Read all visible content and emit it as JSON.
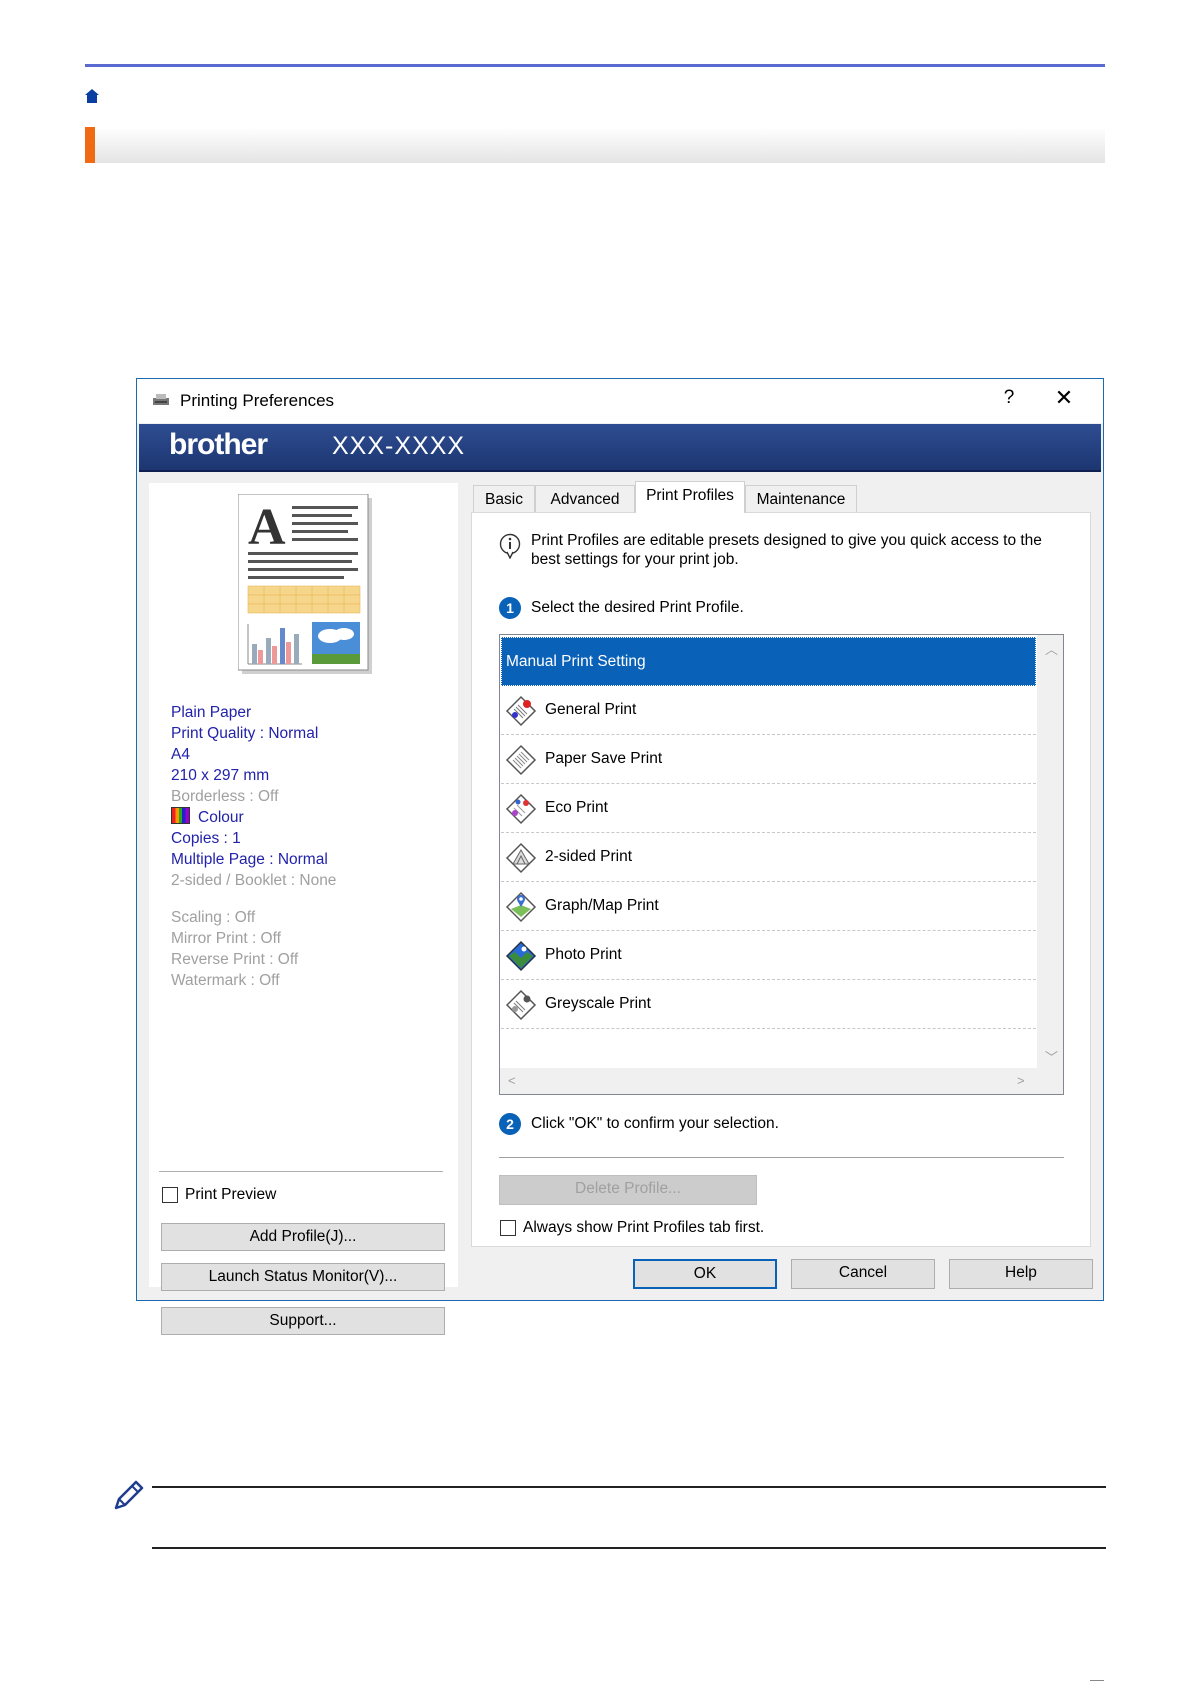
{
  "dialog": {
    "title": "Printing Preferences",
    "help_glyph": "?",
    "close_glyph": "✕",
    "brand": "brother",
    "model": "XXX-XXXX"
  },
  "preview": {
    "settings_summary": [
      {
        "text": "Plain Paper",
        "state": "active"
      },
      {
        "text": "Print Quality : Normal",
        "state": "active"
      },
      {
        "text": "A4",
        "state": "active"
      },
      {
        "text": "210 x 297 mm",
        "state": "active"
      },
      {
        "text": "Borderless : Off",
        "state": "inactive"
      },
      {
        "text": "Colour",
        "state": "active",
        "icon": "colour-swatch-icon"
      },
      {
        "text": "Copies : 1",
        "state": "active"
      },
      {
        "text": "Multiple Page : Normal",
        "state": "active"
      },
      {
        "text": "2-sided / Booklet : None",
        "state": "inactive"
      }
    ],
    "settings_extra": [
      "Scaling : Off",
      "Mirror Print : Off",
      "Reverse Print : Off",
      "Watermark : Off"
    ],
    "print_preview_label": "Print Preview",
    "print_preview_checked": false,
    "buttons": {
      "add_profile": "Add Profile(J)...",
      "launch_status": "Launch Status Monitor(V)...",
      "support": "Support..."
    }
  },
  "tabs": [
    {
      "label": "Basic",
      "active": false
    },
    {
      "label": "Advanced",
      "active": false
    },
    {
      "label": "Print Profiles",
      "active": true
    },
    {
      "label": "Maintenance",
      "active": false
    }
  ],
  "profiles_tab": {
    "info_text": "Print Profiles are editable presets designed to give you quick access to the best settings for your print job.",
    "step1_number": "1",
    "step1_text": "Select the desired Print Profile.",
    "profiles": [
      {
        "label": "Manual Print Setting",
        "selected": true,
        "icon": ""
      },
      {
        "label": "General Print",
        "selected": false,
        "icon": "general-print-icon"
      },
      {
        "label": "Paper Save Print",
        "selected": false,
        "icon": "paper-save-icon"
      },
      {
        "label": "Eco Print",
        "selected": false,
        "icon": "eco-print-icon"
      },
      {
        "label": "2-sided Print",
        "selected": false,
        "icon": "two-sided-print-icon"
      },
      {
        "label": "Graph/Map Print",
        "selected": false,
        "icon": "graph-map-icon"
      },
      {
        "label": "Photo Print",
        "selected": false,
        "icon": "photo-print-icon"
      },
      {
        "label": "Greyscale Print",
        "selected": false,
        "icon": "greyscale-print-icon"
      }
    ],
    "step2_number": "2",
    "step2_text": "Click \"OK\" to confirm your selection.",
    "delete_profile": "Delete Profile...",
    "always_show_label": "Always show Print Profiles tab first.",
    "always_show_checked": false
  },
  "footer_buttons": {
    "ok": "OK",
    "cancel": "Cancel",
    "help": "Help"
  },
  "colors": {
    "accent_blue": "#0a61b8",
    "banner": "#2f4d92",
    "section_accent": "#ef6a12",
    "top_rule": "#5b6ad0"
  }
}
